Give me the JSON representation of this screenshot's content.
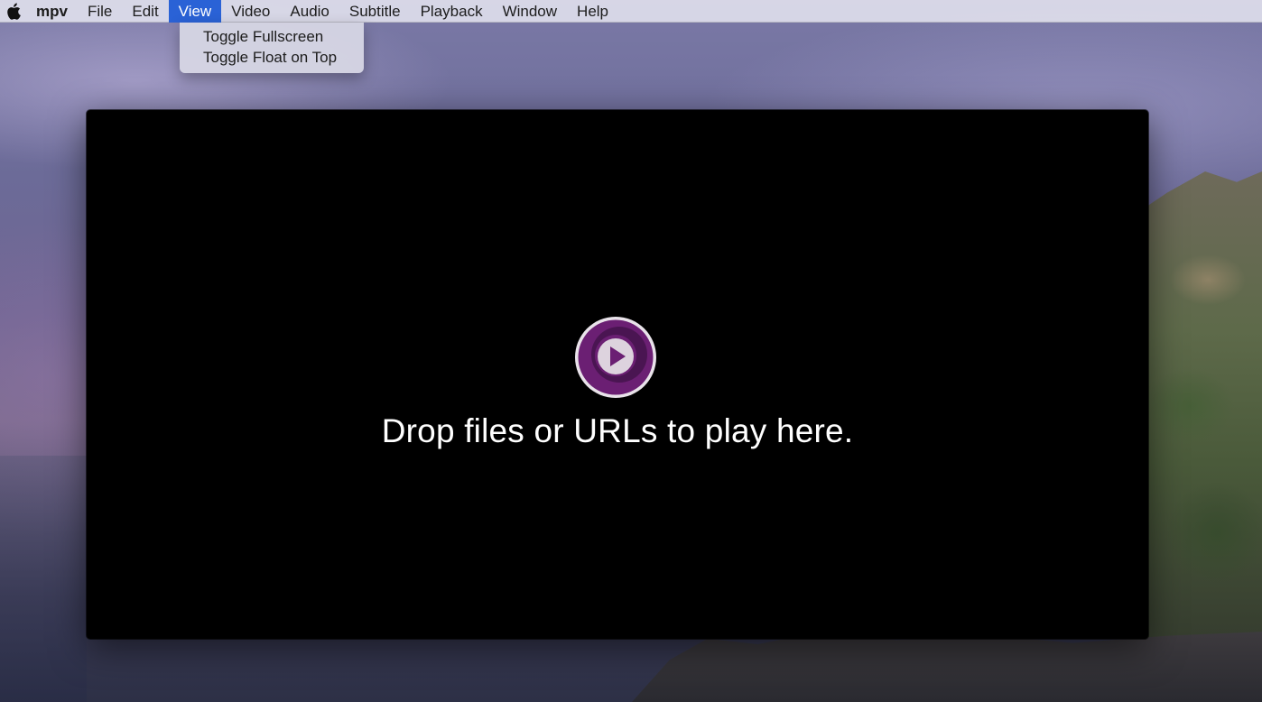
{
  "menubar": {
    "apple_icon": "apple-logo-icon",
    "app_name": "mpv",
    "items": [
      {
        "label": "File"
      },
      {
        "label": "Edit"
      },
      {
        "label": "View"
      },
      {
        "label": "Video"
      },
      {
        "label": "Audio"
      },
      {
        "label": "Subtitle"
      },
      {
        "label": "Playback"
      },
      {
        "label": "Window"
      },
      {
        "label": "Help"
      }
    ],
    "active_menu": "View"
  },
  "view_menu": {
    "items": [
      {
        "label": "Toggle Fullscreen"
      },
      {
        "label": "Toggle Float on Top"
      }
    ]
  },
  "player": {
    "logo_icon": "mpv-logo-icon",
    "message": "Drop files or URLs to play here."
  },
  "colors": {
    "menu_highlight": "#2a62d6",
    "logo_outer": "#6b1f73",
    "logo_ring": "#e9e3ea",
    "player_bg": "#000000"
  }
}
